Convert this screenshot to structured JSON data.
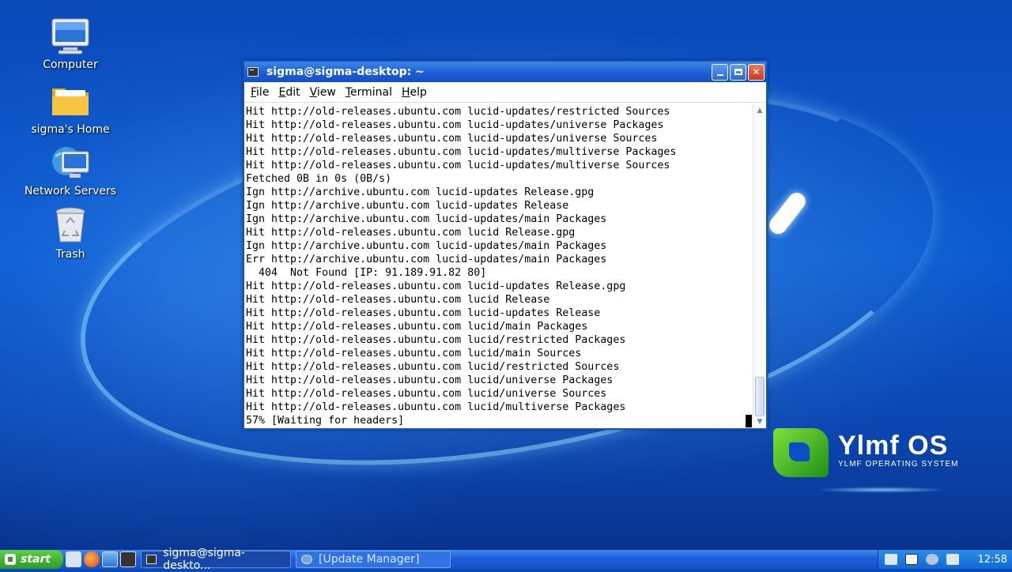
{
  "desktop": {
    "icons": [
      {
        "label": "Computer",
        "icon": "computer-icon"
      },
      {
        "label": "sigma's Home",
        "icon": "folder-icon"
      },
      {
        "label": "Network Servers",
        "icon": "network-icon"
      },
      {
        "label": "Trash",
        "icon": "trash-icon"
      }
    ]
  },
  "window": {
    "title": "sigma@sigma-desktop: ~",
    "menu": [
      "File",
      "Edit",
      "View",
      "Terminal",
      "Help"
    ],
    "menu_mnemonics": [
      "F",
      "E",
      "V",
      "T",
      "H"
    ],
    "lines": [
      "Hit http://old-releases.ubuntu.com lucid-updates/restricted Sources",
      "Hit http://old-releases.ubuntu.com lucid-updates/universe Packages",
      "Hit http://old-releases.ubuntu.com lucid-updates/universe Sources",
      "Hit http://old-releases.ubuntu.com lucid-updates/multiverse Packages",
      "Hit http://old-releases.ubuntu.com lucid-updates/multiverse Sources",
      "Fetched 0B in 0s (0B/s)",
      "Ign http://archive.ubuntu.com lucid-updates Release.gpg",
      "Ign http://archive.ubuntu.com lucid-updates Release",
      "Ign http://archive.ubuntu.com lucid-updates/main Packages",
      "Hit http://old-releases.ubuntu.com lucid Release.gpg",
      "Ign http://archive.ubuntu.com lucid-updates/main Packages",
      "Err http://archive.ubuntu.com lucid-updates/main Packages",
      "  404  Not Found [IP: 91.189.91.82 80]",
      "Hit http://old-releases.ubuntu.com lucid-updates Release.gpg",
      "Hit http://old-releases.ubuntu.com lucid Release",
      "Hit http://old-releases.ubuntu.com lucid-updates Release",
      "Hit http://old-releases.ubuntu.com lucid/main Packages",
      "Hit http://old-releases.ubuntu.com lucid/restricted Packages",
      "Hit http://old-releases.ubuntu.com lucid/main Sources",
      "Hit http://old-releases.ubuntu.com lucid/restricted Sources",
      "Hit http://old-releases.ubuntu.com lucid/universe Packages",
      "Hit http://old-releases.ubuntu.com lucid/universe Sources",
      "Hit http://old-releases.ubuntu.com lucid/multiverse Packages",
      "57% [Waiting for headers]"
    ]
  },
  "logo": {
    "name": "Ylmf OS",
    "tagline": "YLMF OPERATING SYSTEM"
  },
  "taskbar": {
    "start_label": "start",
    "tasks": [
      {
        "label": "sigma@sigma-deskto...",
        "active": true
      },
      {
        "label": "[Update Manager]",
        "active": false
      }
    ],
    "clock": "12:58"
  },
  "colors": {
    "titlebar": "#1c5fd6",
    "taskbar": "#1d5dd8",
    "start": "#2e9a22"
  }
}
